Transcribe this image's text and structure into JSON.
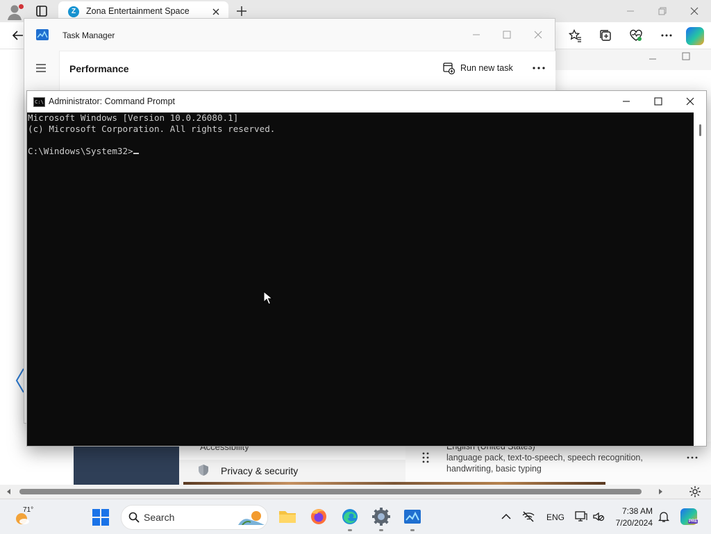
{
  "browser": {
    "tab_title": "Zona Entertainment Space",
    "tab_favicon_letter": "Z",
    "toolbar_icons": [
      "favorites-star-icon",
      "collections-icon",
      "browser-essentials-icon",
      "more-menu-icon",
      "copilot-icon"
    ]
  },
  "task_manager": {
    "title": "Task Manager",
    "page_title": "Performance",
    "run_new_task_label": "Run new task",
    "more_label": "•••"
  },
  "cmd": {
    "title": "Administrator: Command Prompt",
    "icon_label": "C:\\",
    "lines": [
      "Microsoft Windows [Version 10.0.26080.1]",
      "(c) Microsoft Corporation. All rights reserved.",
      "",
      "C:\\Windows\\System32>"
    ]
  },
  "settings": {
    "accessibility_partial": "Accessibility",
    "privacy_label": "Privacy & security",
    "language_partial": "English (United States)",
    "language_desc": "language pack, text-to-speech, speech recognition, handwriting, basic typing"
  },
  "taskbar": {
    "weather_temp": "71°",
    "search_label": "Search",
    "tray_language": "ENG",
    "time": "7:38 AM",
    "date": "7/20/2024",
    "copilot_badge": "PRE"
  }
}
